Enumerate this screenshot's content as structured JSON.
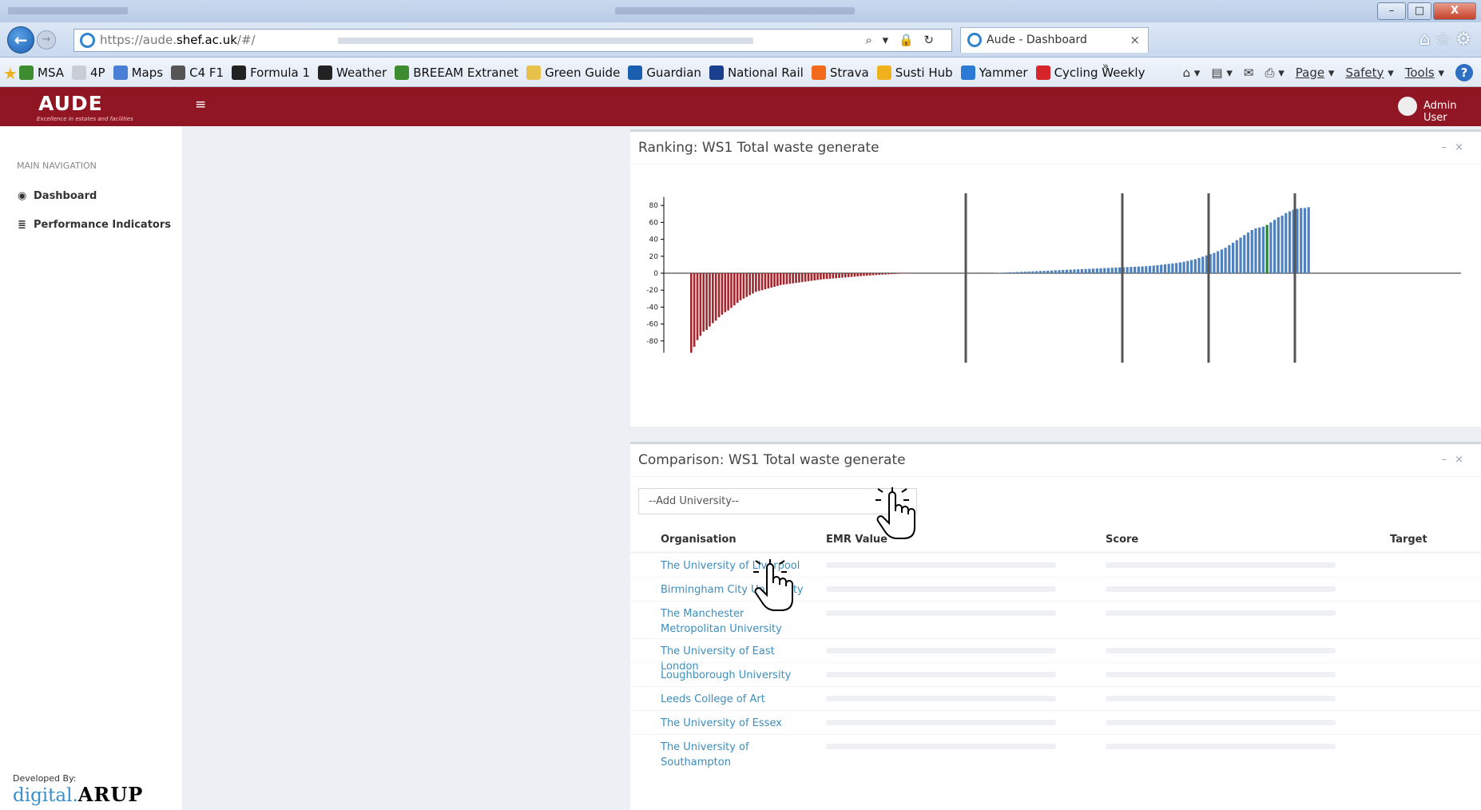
{
  "browser": {
    "url_prefix": "https://aude.",
    "url_domain": "shef.ac.uk",
    "url_suffix": "/#/",
    "tab_title": "Aude - Dashboard",
    "tab_close": "×",
    "address_tools": "⌕ ▾ 🔒 ↻",
    "window_buttons": {
      "minimize": "–",
      "maximize": "□",
      "close": "X"
    },
    "right_icons": "⌂☆⚙",
    "favorites": [
      {
        "label": "MSA",
        "color": "#3d8c2f"
      },
      {
        "label": "4P",
        "color": "#c9ced6"
      },
      {
        "label": "Maps",
        "color": "#4a7fd6"
      },
      {
        "label": "C4 F1",
        "color": "#555555"
      },
      {
        "label": "Formula 1",
        "color": "#222222"
      },
      {
        "label": "Weather",
        "color": "#222222"
      },
      {
        "label": "BREEAM Extranet",
        "color": "#3d8c2f"
      },
      {
        "label": "Green Guide",
        "color": "#e8c14a"
      },
      {
        "label": "Guardian",
        "color": "#1b5fb0"
      },
      {
        "label": "National Rail",
        "color": "#1b3f8f"
      },
      {
        "label": "Strava",
        "color": "#f26b1d"
      },
      {
        "label": "Susti Hub",
        "color": "#f0b21c"
      },
      {
        "label": "Yammer",
        "color": "#2d7ad6"
      },
      {
        "label": "Cycling Weekly",
        "color": "#d6262b"
      }
    ],
    "favorites_more": "»",
    "command_bar": {
      "page": "Page",
      "safety": "Safety",
      "tools": "Tools",
      "help": "?"
    }
  },
  "header": {
    "logo": "AUDE",
    "tagline": "Excellence in estates and facilities",
    "menu_icon": "≡",
    "user_name": "Admin User"
  },
  "sidebar": {
    "section_label": "MAIN NAVIGATION",
    "items": [
      {
        "label": "Dashboard",
        "icon": "dashboard-icon"
      },
      {
        "label": "Performance Indicators",
        "icon": "list-icon"
      }
    ],
    "developed_by": "Developed By:",
    "dev_logo_prefix": "digital.",
    "dev_logo_brand": "ARUP"
  },
  "ranking": {
    "title": "Ranking: WS1 Total waste generate",
    "tools": {
      "collapse": "–",
      "remove": "×"
    }
  },
  "comparison": {
    "title": "Comparison: WS1 Total waste generate",
    "tools": {
      "collapse": "–",
      "remove": "×"
    },
    "add_placeholder": "--Add University--",
    "columns": [
      "Organisation",
      "EMR Value",
      "Score",
      "Target"
    ],
    "rows": [
      "The University of Liverpool",
      "Birmingham City University",
      "The Manchester Metropolitan University",
      "The University of East London",
      "Loughborough University",
      "Leeds College of Art",
      "The University of Essex",
      "The University of Southampton"
    ]
  },
  "chart_data": {
    "type": "bar",
    "title": "Ranking: WS1 Total waste generate",
    "xlabel": "",
    "ylabel": "",
    "ylim": [
      -95,
      95
    ],
    "yticks": [
      80,
      60,
      40,
      20,
      0,
      -20,
      -40,
      -60,
      -80
    ],
    "grid": false,
    "colors": {
      "negative": "#a4262c",
      "positive": "#4e81bd",
      "highlight": "#1d8a2b",
      "divider": "#555555"
    },
    "highlight_note": "one bar highlighted in green",
    "negative_values": [
      -94,
      -87,
      -79,
      -74,
      -69,
      -67,
      -63,
      -59,
      -56,
      -52,
      -49,
      -46,
      -44,
      -41,
      -38,
      -35,
      -32,
      -30,
      -28,
      -26,
      -24,
      -22,
      -21,
      -20,
      -19,
      -18,
      -17,
      -16,
      -15,
      -14,
      -13.5,
      -13,
      -12.5,
      -12,
      -11.5,
      -11,
      -10.5,
      -10,
      -9.5,
      -9,
      -8.5,
      -8,
      -7.5,
      -7,
      -6.8,
      -6.5,
      -6.2,
      -6,
      -5.6,
      -5.3,
      -5,
      -4.7,
      -4.4,
      -4.1,
      -3.8,
      -3.5,
      -3.2,
      -3,
      -2.7,
      -2.4,
      -2.2,
      -2,
      -1.7,
      -1.5,
      -1.3,
      -1.1,
      -0.9,
      -0.7,
      -0.5,
      -0.4,
      -0.3,
      -0.2,
      -0.1
    ],
    "positive_values": [
      0.2,
      0.4,
      0.6,
      0.8,
      1,
      1.2,
      1.4,
      1.6,
      1.8,
      2,
      2.2,
      2.4,
      2.6,
      2.8,
      3,
      3.2,
      3.4,
      3.6,
      3.8,
      4,
      4.2,
      4.4,
      4.6,
      4.8,
      5,
      5.2,
      5.4,
      5.6,
      5.8,
      6,
      6.2,
      6.4,
      6.6,
      6.8,
      7,
      7.2,
      7.4,
      7.6,
      7.8,
      8,
      8.3,
      8.6,
      9,
      9.5,
      10,
      10.5,
      11,
      11.5,
      12,
      12.8,
      13.5,
      14.5,
      15.5,
      16.5,
      18,
      19.5,
      21,
      22.5,
      24,
      26,
      28,
      30,
      33,
      36,
      39,
      42,
      45,
      48,
      51,
      53,
      54,
      55,
      57,
      60,
      63,
      66,
      68,
      71,
      73,
      75,
      76,
      77,
      77,
      78
    ],
    "highlight_positive_index": 72
  }
}
